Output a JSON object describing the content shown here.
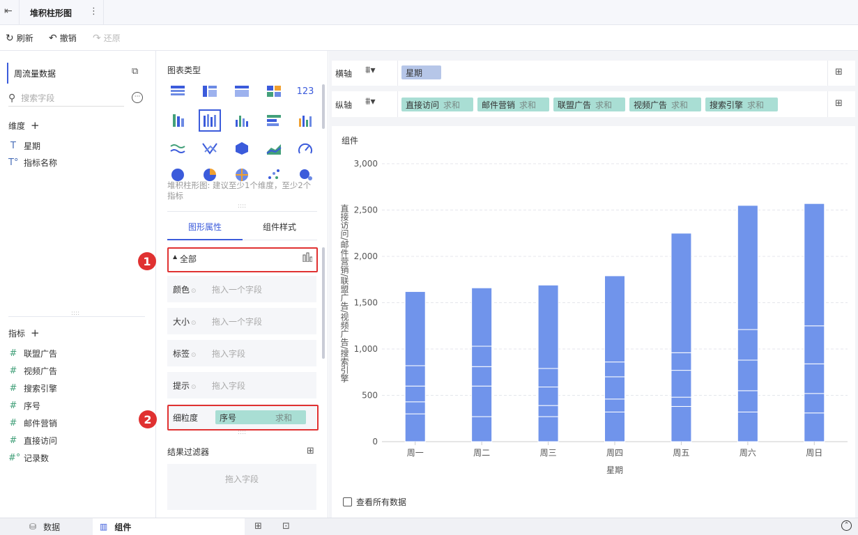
{
  "topbar": {
    "title": "堆积柱形图",
    "more": "⋮"
  },
  "toolbar": {
    "refresh": "刷新",
    "undo": "撤销",
    "redo": "还原"
  },
  "left": {
    "dataset": "周流量数据",
    "search_placeholder": "搜索字段",
    "dimensions_title": "维度",
    "dimensions": [
      {
        "icon": "T",
        "label": "星期"
      },
      {
        "icon": "T°",
        "label": "指标名称"
      }
    ],
    "measures_title": "指标",
    "measures": [
      {
        "icon": "#",
        "label": "联盟广告"
      },
      {
        "icon": "#",
        "label": "视频广告"
      },
      {
        "icon": "#",
        "label": "搜索引擎"
      },
      {
        "icon": "#",
        "label": "序号"
      },
      {
        "icon": "#",
        "label": "邮件营销"
      },
      {
        "icon": "#",
        "label": "直接访问"
      },
      {
        "icon": "#°",
        "label": "记录数"
      }
    ]
  },
  "mid": {
    "chart_type_title": "图表类型",
    "chart_hint": "堆积柱形图: 建议至少1个维度，至少2个指标",
    "tabs": [
      "图形属性",
      "组件样式"
    ],
    "all_label": "全部",
    "rows": [
      {
        "label": "颜色",
        "hint": "拖入一个字段"
      },
      {
        "label": "大小",
        "hint": "拖入一个字段"
      },
      {
        "label": "标签",
        "hint": "拖入字段"
      },
      {
        "label": "提示",
        "hint": "拖入字段"
      }
    ],
    "granularity": {
      "label": "细粒度",
      "field": "序号",
      "agg": "求和"
    },
    "filter_title": "结果过滤器",
    "filter_hint": "拖入字段",
    "badges": [
      "1",
      "2"
    ]
  },
  "axes": {
    "x_label": "横轴",
    "y_label": "纵轴",
    "x_field": "星期",
    "y_fields": [
      {
        "name": "直接访问",
        "agg": "求和"
      },
      {
        "name": "邮件营销",
        "agg": "求和"
      },
      {
        "name": "联盟广告",
        "agg": "求和"
      },
      {
        "name": "视频广告",
        "agg": "求和"
      },
      {
        "name": "搜索引擎",
        "agg": "求和"
      }
    ]
  },
  "chart_title": "组件",
  "show_all": "查看所有数据",
  "bottom": {
    "data_tab": "数据",
    "component_tab": "组件"
  },
  "colors": {
    "bar": "#7094eb",
    "pill_blue": "#b6c6e8",
    "pill_green": "#a9ded4",
    "red": "#e03131",
    "accent": "#3b5bdb"
  },
  "chart_data": {
    "type": "bar",
    "stacked": true,
    "categories": [
      "周一",
      "周二",
      "周三",
      "周四",
      "周五",
      "周六",
      "周日"
    ],
    "segments": [
      [
        300,
        130,
        170,
        220,
        800
      ],
      [
        270,
        330,
        210,
        220,
        630
      ],
      [
        270,
        120,
        200,
        200,
        900
      ],
      [
        320,
        140,
        240,
        160,
        930
      ],
      [
        380,
        100,
        290,
        190,
        1290
      ],
      [
        320,
        230,
        330,
        330,
        1340
      ],
      [
        310,
        210,
        320,
        410,
        1320
      ]
    ],
    "ylabel": "直接访问/邮件营销/联盟广告/视频广告/搜索引擎",
    "xlabel": "星期",
    "ylim": [
      0,
      3000
    ],
    "yticks": [
      "0",
      "500",
      "1,000",
      "1,500",
      "2,000",
      "2,500",
      "3,000"
    ],
    "grid": true
  }
}
